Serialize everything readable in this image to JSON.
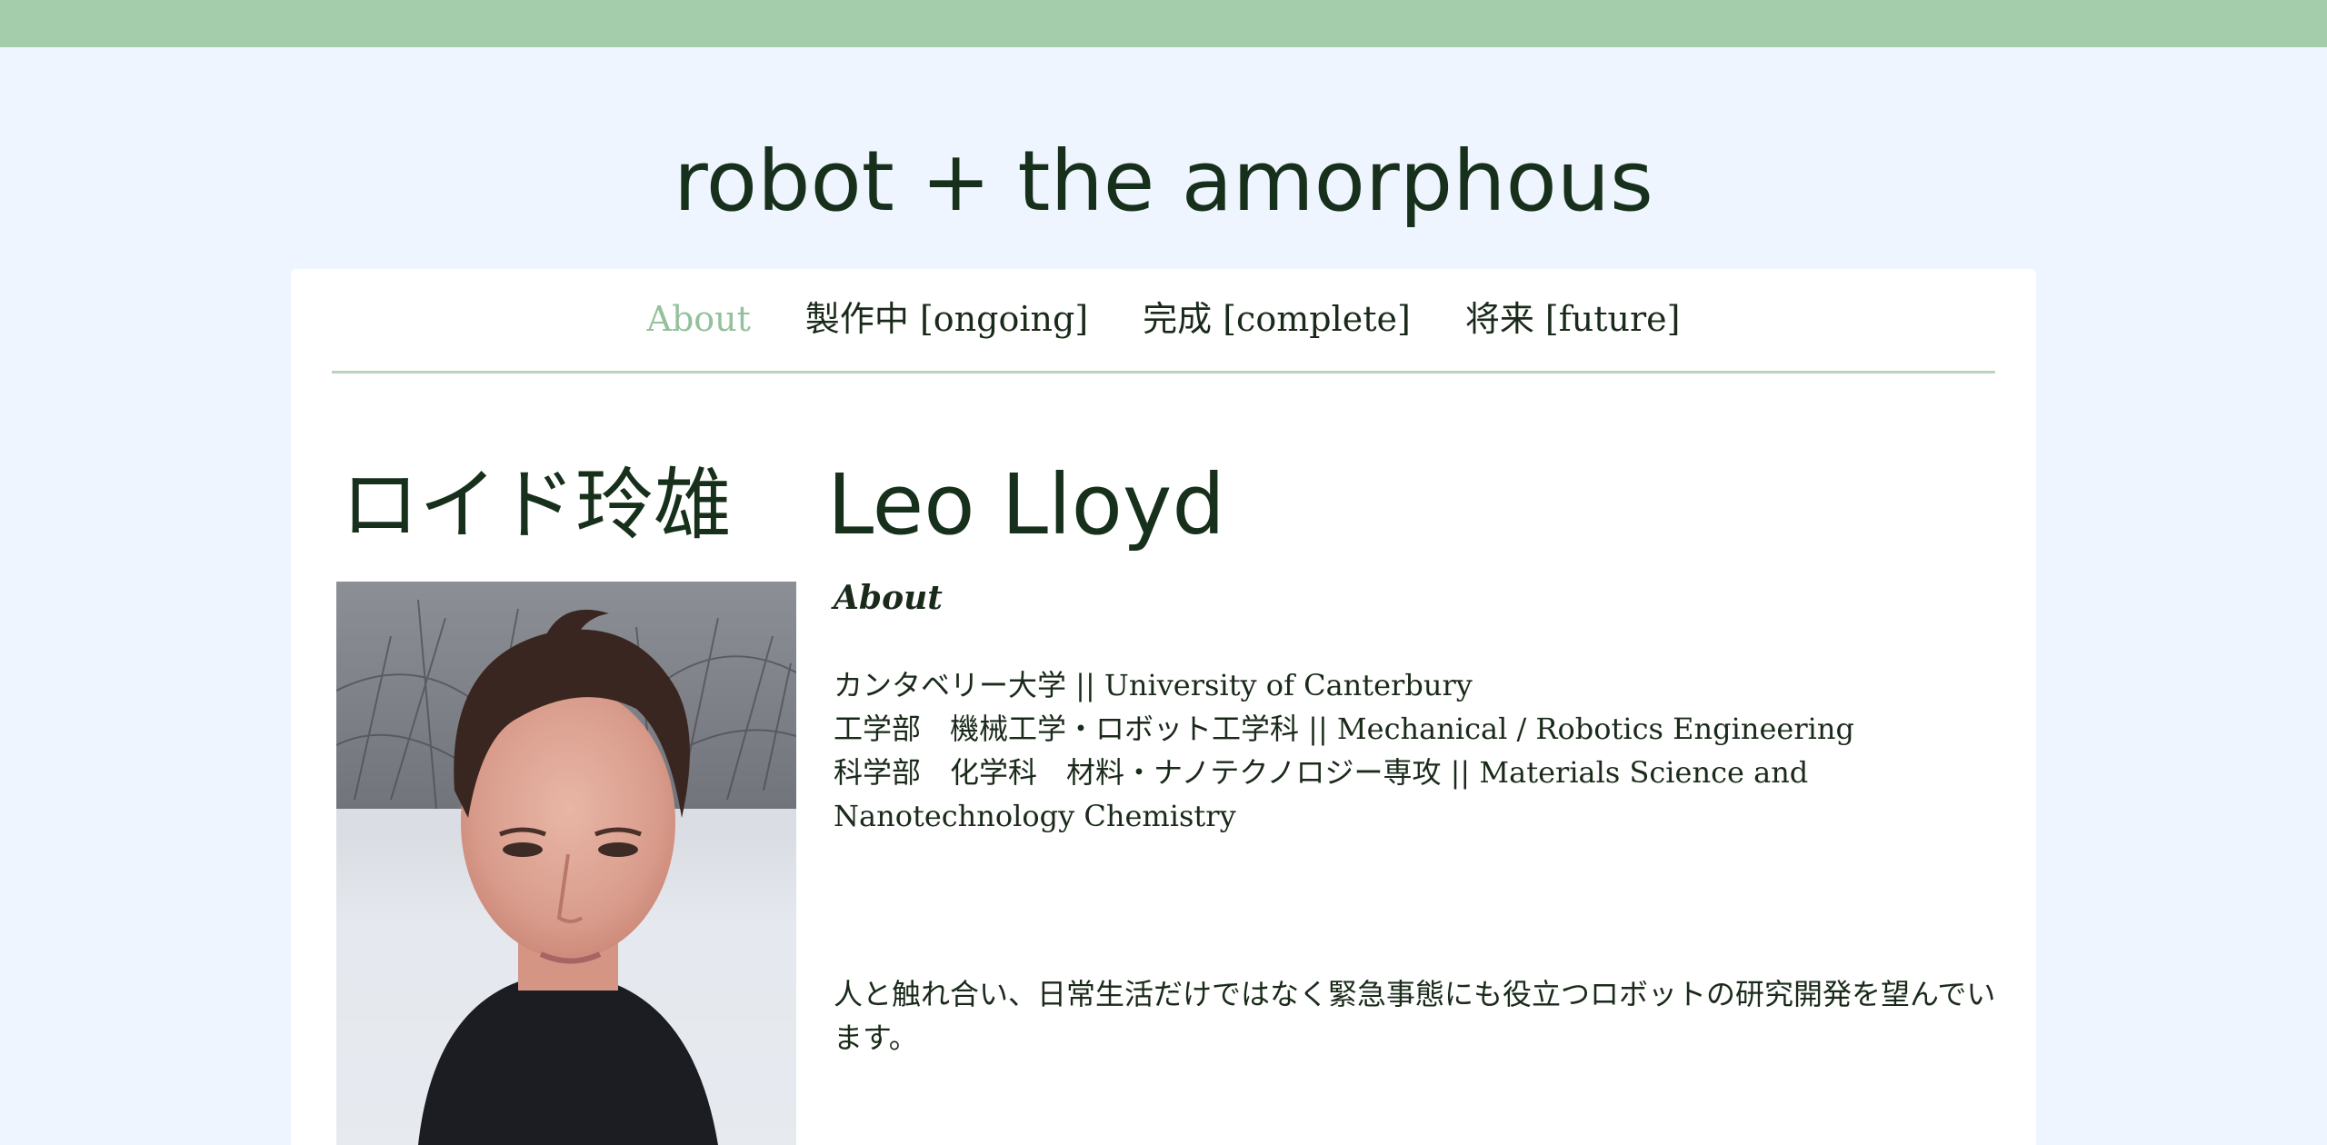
{
  "site": {
    "title": "robot + the amorphous",
    "colors": {
      "top_bar": "#a4cdab",
      "background": "#eef5ff",
      "card": "#ffffff",
      "nav_active": "#93c19c",
      "text": "#17301b"
    }
  },
  "nav": {
    "items": [
      {
        "label": "About",
        "active": true
      },
      {
        "label": "製作中 [ongoing]",
        "active": false
      },
      {
        "label": "完成 [complete]",
        "active": false
      },
      {
        "label": "将来 [future]",
        "active": false
      }
    ]
  },
  "profile": {
    "name_jp": "ロイド玲雄",
    "name_en": "Leo Lloyd",
    "section_label": "About",
    "info": [
      "カンタベリー大学 || University of Canterbury",
      "工学部　機械工学・ロボット工学科 || Mechanical / Robotics Engineering",
      "科学部　化学科　材料・ナノテクノロジー専攻 || Materials Science and Nanotechnology Chemistry"
    ],
    "tagline": "人と触れ合い、日常生活だけではなく緊急事態にも役立つロボットの研究開発を望んでいます。",
    "photo_icon": "portrait-photo"
  }
}
